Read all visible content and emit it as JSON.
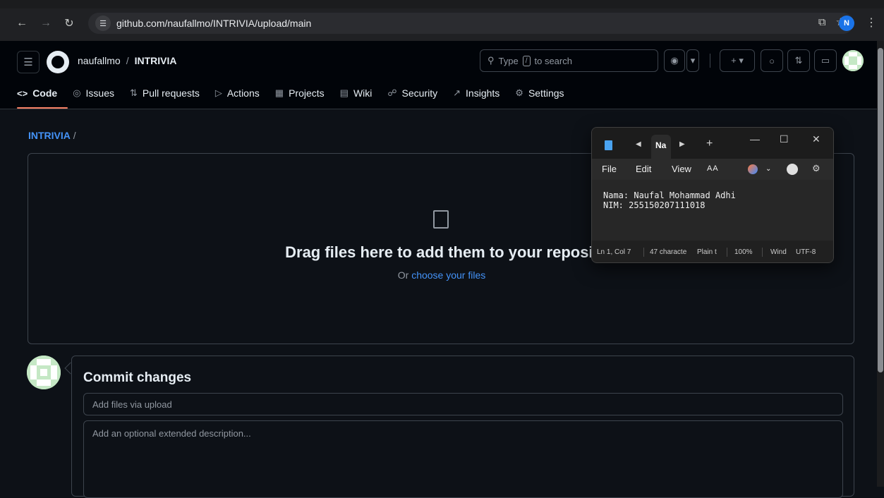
{
  "browser": {
    "url": "github.com/naufallmo/INTRIVIA/upload/main",
    "profile_initial": "N"
  },
  "header": {
    "owner": "naufallmo",
    "separator": "/",
    "repo": "INTRIVIA",
    "search_prefix": "Type",
    "search_key": "/",
    "search_suffix": "to search"
  },
  "tabs": [
    {
      "label": "Code",
      "icon": "code-icon"
    },
    {
      "label": "Issues",
      "icon": "issue-icon"
    },
    {
      "label": "Pull requests",
      "icon": "pull-request-icon"
    },
    {
      "label": "Actions",
      "icon": "play-icon"
    },
    {
      "label": "Projects",
      "icon": "table-icon"
    },
    {
      "label": "Wiki",
      "icon": "book-icon"
    },
    {
      "label": "Security",
      "icon": "shield-icon"
    },
    {
      "label": "Insights",
      "icon": "graph-icon"
    },
    {
      "label": "Settings",
      "icon": "gear-icon"
    }
  ],
  "upload": {
    "path_repo": "INTRIVIA",
    "path_sep": "/",
    "drop_title": "Drag files here to add them to your reposit",
    "drop_sub_prefix": "Or",
    "drop_sub_link": "choose your files"
  },
  "commit": {
    "title": "Commit changes",
    "summary_placeholder": "Add files via upload",
    "description_placeholder": "Add an optional extended description..."
  },
  "notepad": {
    "tab_label": "Na",
    "menu": [
      "File",
      "Edit",
      "View"
    ],
    "content": "Nama: Naufal Mohammad Adhi\nNIM: 255150207111018",
    "status": {
      "position": "Ln 1, Col 7",
      "characters": "47 characte",
      "format": "Plain t",
      "zoom": "100%",
      "line_ending": "Wind",
      "encoding": "UTF-8"
    }
  },
  "colors": {
    "accent_link": "#4493f8",
    "tab_underline": "#f78166",
    "page_bg": "#0d1117"
  }
}
